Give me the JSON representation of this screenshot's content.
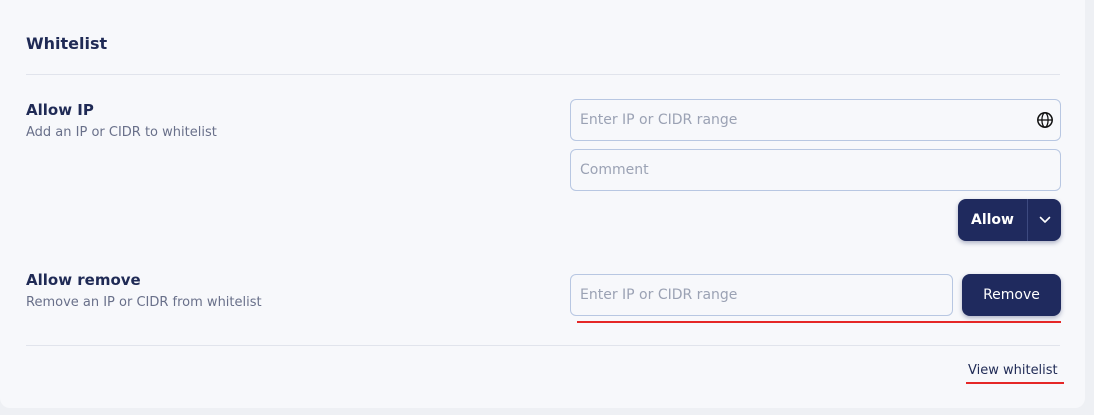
{
  "whitelist": {
    "title": "Whitelist",
    "allow_ip": {
      "title": "Allow IP",
      "description": "Add an IP or CIDR to whitelist",
      "ip_placeholder": "Enter IP or CIDR range",
      "comment_placeholder": "Comment",
      "allow_label": "Allow",
      "ip_icon": "globe-icon",
      "toggle_icon": "chevron-down-icon"
    },
    "allow_remove": {
      "title": "Allow remove",
      "description": "Remove an IP or CIDR from whitelist",
      "ip_placeholder": "Enter IP or CIDR range",
      "remove_label": "Remove"
    },
    "view_link": "View whitelist"
  },
  "colors": {
    "primary_button": "#1f2a5e",
    "highlight_underline": "#e52727",
    "heading_text": "#1f2a55"
  }
}
